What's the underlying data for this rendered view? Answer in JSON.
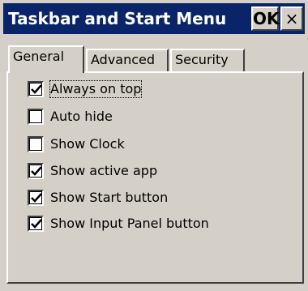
{
  "window": {
    "title": "Taskbar and Start Menu",
    "ok_label": "OK",
    "close_label": "×"
  },
  "tabs": [
    {
      "label": "General",
      "active": true
    },
    {
      "label": "Advanced",
      "active": false
    },
    {
      "label": "Security",
      "active": false
    }
  ],
  "options": [
    {
      "label": "Always on top",
      "checked": true,
      "focused": true
    },
    {
      "label": "Auto hide",
      "checked": false,
      "focused": false
    },
    {
      "label": "Show Clock",
      "checked": false,
      "focused": false
    },
    {
      "label": "Show active app",
      "checked": true,
      "focused": false
    },
    {
      "label": "Show Start button",
      "checked": true,
      "focused": false
    },
    {
      "label": "Show Input Panel button",
      "checked": true,
      "focused": false
    }
  ],
  "colors": {
    "titlebar": "#0a246a",
    "face": "#d4d0c8",
    "checkbox_bg": "#ffffff"
  }
}
